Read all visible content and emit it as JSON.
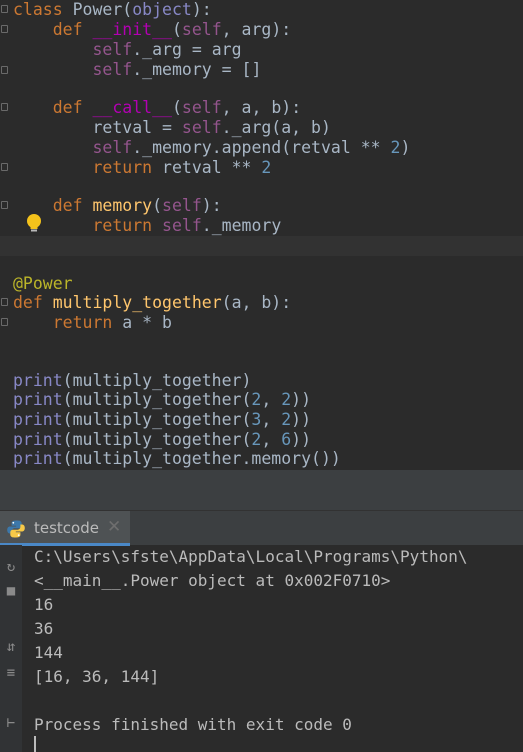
{
  "editor": {
    "lines": [
      [
        "class ",
        "Power",
        "(",
        "object",
        "):"
      ],
      [
        "    ",
        "def ",
        "__init__",
        "(",
        "self",
        ", arg):"
      ],
      [
        "        ",
        "self",
        "._arg = arg"
      ],
      [
        "        ",
        "self",
        "._memory = []"
      ],
      [],
      [
        "    ",
        "def ",
        "__call__",
        "(",
        "self",
        ", a, b):"
      ],
      [
        "        retval = ",
        "self",
        "._arg(a, b)"
      ],
      [
        "        ",
        "self",
        "._memory.append(retval ** ",
        "2",
        ")"
      ],
      [
        "        ",
        "return ",
        "retval ** ",
        "2"
      ],
      [],
      [
        "    ",
        "def ",
        "memory",
        "(",
        "self",
        "):"
      ],
      [
        "        ",
        "return ",
        "self",
        "._memory"
      ],
      [],
      [],
      [
        "@Power"
      ],
      [
        "def ",
        "multiply_together",
        "(a, b):"
      ],
      [
        "    ",
        "return ",
        "a * b"
      ],
      [],
      [],
      [
        "print",
        "(multiply_together)"
      ],
      [
        "print",
        "(multiply_together(",
        "2",
        ", ",
        "2",
        "))"
      ],
      [
        "print",
        "(multiply_together(",
        "3",
        ", ",
        "2",
        "))"
      ],
      [
        "print",
        "(multiply_together(",
        "2",
        ", ",
        "6",
        "))"
      ],
      [
        "print",
        "(multiply_together.memory())"
      ]
    ]
  },
  "run_panel": {
    "tab_label": "testcode",
    "tab_close_glyph": "✕",
    "output_lines": [
      "C:\\Users\\sfste\\AppData\\Local\\Programs\\Python\\",
      "<__main__.Power object at 0x002F0710>",
      "16",
      "36",
      "144",
      "[16, 36, 144]",
      "",
      "Process finished with exit code 0"
    ]
  },
  "icons": {
    "intention_bulb": "lightbulb-icon",
    "python_file": "python-icon",
    "gutter": [
      "rerun-icon",
      "stop-icon",
      "soft-wrap-icon",
      "pin-icon"
    ]
  },
  "colors": {
    "background": "#2b2b2b",
    "keyword": "#cc7832",
    "self": "#94558d",
    "magic_method": "#b200b2",
    "number": "#6897bb",
    "decorator": "#bbb529",
    "builtin": "#8888c6",
    "text": "#a9b7c6"
  }
}
